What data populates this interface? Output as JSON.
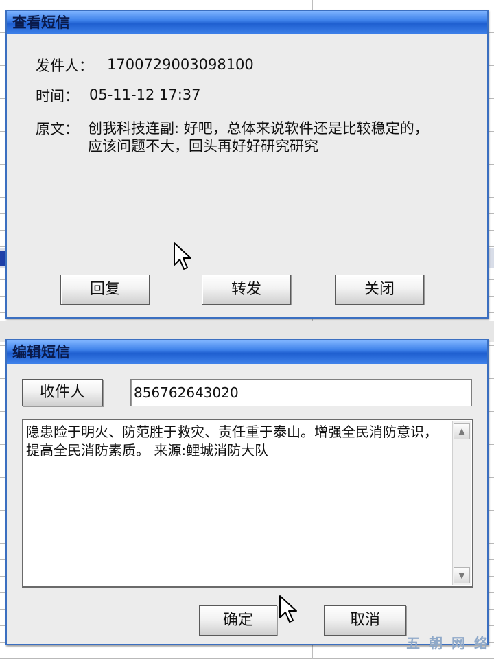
{
  "view_dialog": {
    "title": "查看短信",
    "sender_label": "发件人：",
    "sender_value": "1700729003098100",
    "time_label": "时间：",
    "time_value": "05-11-12 17:37",
    "original_label": "原文：",
    "original_value": "创我科技连副: 好吧，总体来说软件还是比较稳定的，应该问题不大，回头再好好研究研究",
    "buttons": {
      "reply": "回复",
      "forward": "转发",
      "close": "关闭"
    }
  },
  "edit_dialog": {
    "title": "编辑短信",
    "recipient_button": "收件人",
    "recipient_value": "856762643020",
    "message_body": "隐患险于明火、防范胜于救灾、责任重于泰山。增强全民消防意识，提高全民消防素质。 来源:鲤城消防大队",
    "buttons": {
      "ok": "确定",
      "cancel": "取消"
    }
  },
  "watermark": "五 朝 网 络",
  "icons": {
    "cursor": "mouse-pointer-icon",
    "scroll_up": "scroll-up-arrow-icon",
    "scroll_down": "scroll-down-arrow-icon"
  },
  "colors": {
    "titlebar": "#3f82ea",
    "dialog_bg": "#ececec"
  }
}
